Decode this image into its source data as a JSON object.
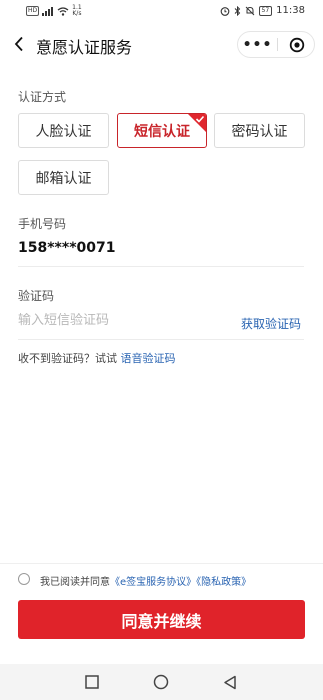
{
  "status_bar": {
    "network_badge": "HD",
    "speed_value": "1.1",
    "speed_unit": "K/s",
    "battery": "57",
    "time": "11:38",
    "icons": [
      "hd-icon",
      "signal-icon",
      "wifi-icon",
      "alarm-icon",
      "bluetooth-icon",
      "mute-icon",
      "battery-icon"
    ]
  },
  "nav": {
    "title": "意愿认证服务",
    "more_label": "•••",
    "icons": [
      "back-icon",
      "more-icon",
      "close-target-icon"
    ]
  },
  "auth_methods": {
    "label": "认证方式",
    "options": [
      {
        "label": "人脸认证",
        "selected": false
      },
      {
        "label": "短信认证",
        "selected": true
      },
      {
        "label": "密码认证",
        "selected": false
      },
      {
        "label": "邮箱认证",
        "selected": false
      }
    ]
  },
  "phone": {
    "label": "手机号码",
    "value": "158****0071"
  },
  "code": {
    "label": "验证码",
    "placeholder": "输入短信验证码",
    "get_code_label": "获取验证码",
    "no_code_text": "收不到验证码？试试",
    "voice_code_label": "语音验证码"
  },
  "agreement": {
    "prefix": "我已阅读并同意",
    "service_link": "《e签宝服务协议》",
    "privacy_link": "《隐私政策》",
    "checked": false
  },
  "submit_label": "同意并继续",
  "colors": {
    "accent_red": "#e0232a",
    "link_blue": "#2a64b2"
  },
  "system_nav": {
    "icons": [
      "square-icon",
      "circle-icon",
      "triangle-back-icon"
    ]
  }
}
